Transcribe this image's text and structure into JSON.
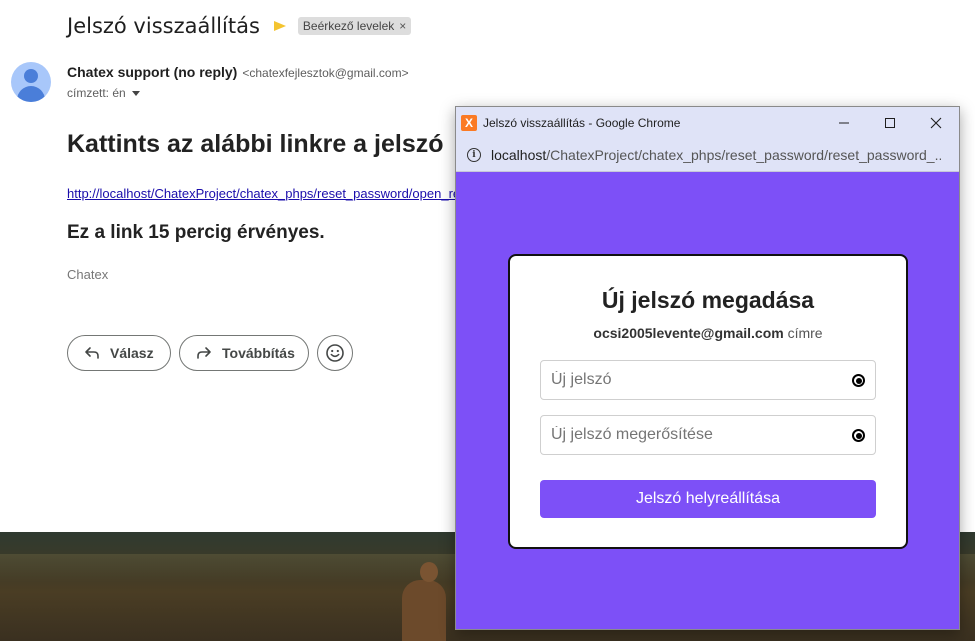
{
  "email": {
    "subject": "Jelszó visszaállítás",
    "label_chip": "Beérkező levelek",
    "label_chip_close": "×",
    "sender_name": "Chatex support (no reply)",
    "sender_email": "<chatexfejlesztok@gmail.com>",
    "recipient": "címzett: én",
    "heading": "Kattints az alábbi linkre a jelszó",
    "link": "http://localhost/ChatexProject/chatex_phps/reset_password/open_re",
    "valid_text": "Ez a link 15 percig érvényes.",
    "signature": "Chatex",
    "reply_label": "Válasz",
    "forward_label": "Továbbítás",
    "icons": [
      "avatar-icon",
      "importance-marker-icon",
      "reply-icon",
      "forward-icon",
      "emoji-icon"
    ]
  },
  "popup": {
    "window_title": "Jelszó visszaállítás - Google Chrome",
    "app_icon_glyph": "X",
    "url_host": "localhost",
    "url_path": "/ChatexProject/chatex_phps/reset_password/reset_password_...",
    "card": {
      "title": "Új jelszó megadása",
      "email": "ocsi2005levente@gmail.com",
      "email_suffix": " címre",
      "new_password_placeholder": "Új jelszó",
      "confirm_password_placeholder": "Új jelszó megerősítése",
      "submit_label": "Jelszó helyreállítása"
    },
    "colors": {
      "accent": "#7d50f7",
      "titlebar": "#dfe3f7"
    }
  }
}
